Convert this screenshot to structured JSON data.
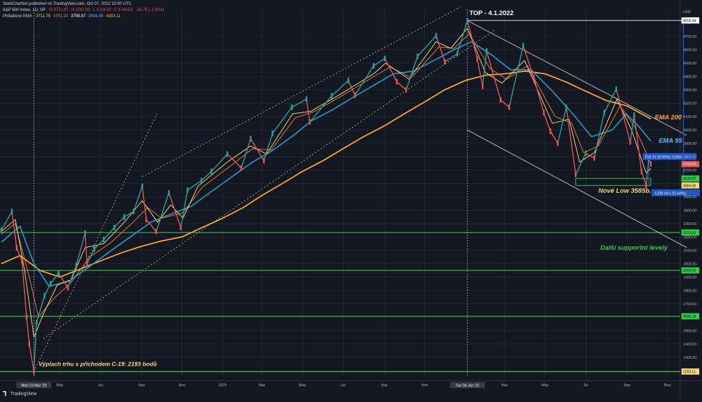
{
  "header": {
    "published": "StarkCharttist published on TradingView.com, Oct 07, 2022 10:00 UTC",
    "symbol_line": "S&P 500 Index, 1D, SP",
    "ohlc": [
      {
        "k": "O",
        "v": "3771.97",
        "c": "#ef5350"
      },
      {
        "k": "H",
        "v": "3797.93",
        "c": "#ef5350"
      },
      {
        "k": "L",
        "v": "3718.32",
        "c": "#ef5350"
      },
      {
        "k": "C",
        "v": "3744.52",
        "c": "#ef5350"
      },
      {
        "k": "",
        "v": "-38.76 (-1.02%)",
        "c": "#ef5350"
      }
    ],
    "indicator_name": "Phillabone EMA",
    "indicator_values": [
      {
        "v": "3711.79",
        "c": "#f5d76e"
      },
      {
        "v": "3751.20",
        "c": "#e07b39"
      },
      {
        "v": "3798.87",
        "c": "#ffffff"
      },
      {
        "v": "3916.06",
        "c": "#4fc3f7"
      },
      {
        "v": "4083.11",
        "c": "#ffa726"
      }
    ]
  },
  "footer": {
    "brand": "TradingView"
  },
  "colors": {
    "background": "#131722",
    "grid": "#2a2e39",
    "up": "#26a69a",
    "down": "#ef5350",
    "ema_fast": "#f5d76e",
    "ema_mid": "#e07b39",
    "ema55": "#1fa0d0",
    "ema200": "#ffa726",
    "support": "#2ecc40",
    "channel": "#c8c8c8",
    "dotted_channel": "#c9b458"
  },
  "chart_data": {
    "type": "line",
    "title": "S&P 500 Index, 1D, SP",
    "y_axis_label": "USD",
    "ylim": [
      2150,
      4900
    ],
    "y_ticks": [
      2300,
      2400,
      2500,
      2600,
      2700,
      2800,
      2900,
      3000,
      3100,
      3200,
      3300,
      3400,
      3500,
      3600,
      3700,
      3800,
      3900,
      4000,
      4100,
      4200,
      4300,
      4400,
      4500,
      4600,
      4700
    ],
    "xlim": [
      "2020-02-01",
      "2022-11-20"
    ],
    "x_ticks": [
      {
        "date": "2020-05-01",
        "label": "May"
      },
      {
        "date": "2020-07-01",
        "label": "Jul"
      },
      {
        "date": "2020-09-01",
        "label": "Sep"
      },
      {
        "date": "2020-11-01",
        "label": "Nov"
      },
      {
        "date": "2021-01-01",
        "label": "2021"
      },
      {
        "date": "2021-03-01",
        "label": "Mar"
      },
      {
        "date": "2021-05-01",
        "label": "May"
      },
      {
        "date": "2021-07-01",
        "label": "Jul"
      },
      {
        "date": "2021-09-01",
        "label": "Sep"
      },
      {
        "date": "2021-11-01",
        "label": "Nov"
      },
      {
        "date": "2022-03-01",
        "label": "Mar"
      },
      {
        "date": "2022-05-01",
        "label": "May"
      },
      {
        "date": "2022-07-01",
        "label": "Jul"
      },
      {
        "date": "2022-09-01",
        "label": "Sep"
      },
      {
        "date": "2022-11-01",
        "label": "Nov"
      }
    ],
    "x_markers": [
      {
        "date": "2020-03-23",
        "label": "Mon 23 Mar '20"
      },
      {
        "date": "2022-01-04",
        "label": "Tue 04 Jan '22"
      }
    ],
    "price": [
      [
        "2020-02-03",
        3250
      ],
      [
        "2020-02-19",
        3390
      ],
      [
        "2020-02-26",
        3120
      ],
      [
        "2020-03-05",
        3020
      ],
      [
        "2020-03-12",
        2600
      ],
      [
        "2020-03-16",
        2400
      ],
      [
        "2020-03-23",
        2193
      ],
      [
        "2020-03-27",
        2560
      ],
      [
        "2020-04-08",
        2760
      ],
      [
        "2020-04-17",
        2850
      ],
      [
        "2020-04-29",
        2930
      ],
      [
        "2020-05-13",
        2820
      ],
      [
        "2020-05-26",
        2990
      ],
      [
        "2020-06-08",
        3230
      ],
      [
        "2020-06-11",
        3000
      ],
      [
        "2020-06-22",
        3110
      ],
      [
        "2020-07-06",
        3180
      ],
      [
        "2020-07-22",
        3270
      ],
      [
        "2020-08-06",
        3350
      ],
      [
        "2020-08-20",
        3390
      ],
      [
        "2020-09-02",
        3580
      ],
      [
        "2020-09-08",
        3330
      ],
      [
        "2020-09-23",
        3240
      ],
      [
        "2020-10-12",
        3530
      ],
      [
        "2020-10-30",
        3270
      ],
      [
        "2020-11-09",
        3550
      ],
      [
        "2020-11-30",
        3620
      ],
      [
        "2020-12-15",
        3690
      ],
      [
        "2021-01-08",
        3820
      ],
      [
        "2021-01-29",
        3715
      ],
      [
        "2021-02-12",
        3935
      ],
      [
        "2021-03-04",
        3770
      ],
      [
        "2021-03-17",
        3975
      ],
      [
        "2021-04-15",
        4170
      ],
      [
        "2021-05-07",
        4230
      ],
      [
        "2021-05-12",
        4060
      ],
      [
        "2021-06-14",
        4255
      ],
      [
        "2021-07-09",
        4370
      ],
      [
        "2021-07-19",
        4260
      ],
      [
        "2021-08-16",
        4480
      ],
      [
        "2021-09-02",
        4535
      ],
      [
        "2021-09-20",
        4360
      ],
      [
        "2021-10-04",
        4300
      ],
      [
        "2021-10-21",
        4550
      ],
      [
        "2021-11-18",
        4705
      ],
      [
        "2021-12-01",
        4510
      ],
      [
        "2021-12-20",
        4570
      ],
      [
        "2022-01-04",
        4818
      ],
      [
        "2022-01-19",
        4530
      ],
      [
        "2022-01-27",
        4326
      ],
      [
        "2022-02-02",
        4590
      ],
      [
        "2022-02-23",
        4225
      ],
      [
        "2022-03-08",
        4170
      ],
      [
        "2022-03-29",
        4630
      ],
      [
        "2022-04-14",
        4390
      ],
      [
        "2022-04-29",
        4130
      ],
      [
        "2022-05-09",
        3990
      ],
      [
        "2022-05-20",
        3900
      ],
      [
        "2022-06-02",
        4170
      ],
      [
        "2022-06-16",
        3666
      ],
      [
        "2022-07-01",
        3825
      ],
      [
        "2022-07-14",
        3790
      ],
      [
        "2022-07-29",
        4130
      ],
      [
        "2022-08-16",
        4305
      ],
      [
        "2022-09-06",
        3910
      ],
      [
        "2022-09-12",
        4110
      ],
      [
        "2022-09-23",
        3690
      ],
      [
        "2022-09-30",
        3585
      ],
      [
        "2022-10-04",
        3790
      ],
      [
        "2022-10-07",
        3745
      ]
    ],
    "ema200": [
      [
        "2020-02-03",
        3000
      ],
      [
        "2020-03-02",
        3060
      ],
      [
        "2020-04-01",
        2950
      ],
      [
        "2020-05-01",
        2900
      ],
      [
        "2020-06-01",
        2960
      ],
      [
        "2020-07-01",
        3020
      ],
      [
        "2020-08-01",
        3080
      ],
      [
        "2020-09-01",
        3130
      ],
      [
        "2020-10-01",
        3170
      ],
      [
        "2020-11-01",
        3200
      ],
      [
        "2020-12-01",
        3270
      ],
      [
        "2021-01-01",
        3340
      ],
      [
        "2021-02-01",
        3420
      ],
      [
        "2021-03-01",
        3510
      ],
      [
        "2021-04-01",
        3600
      ],
      [
        "2021-05-01",
        3690
      ],
      [
        "2021-06-01",
        3770
      ],
      [
        "2021-07-01",
        3860
      ],
      [
        "2021-08-01",
        3950
      ],
      [
        "2021-09-01",
        4030
      ],
      [
        "2021-10-01",
        4120
      ],
      [
        "2021-11-01",
        4210
      ],
      [
        "2021-12-01",
        4300
      ],
      [
        "2022-01-01",
        4370
      ],
      [
        "2022-02-01",
        4410
      ],
      [
        "2022-03-01",
        4420
      ],
      [
        "2022-04-01",
        4440
      ],
      [
        "2022-05-01",
        4420
      ],
      [
        "2022-06-01",
        4360
      ],
      [
        "2022-07-01",
        4290
      ],
      [
        "2022-08-01",
        4220
      ],
      [
        "2022-09-01",
        4180
      ],
      [
        "2022-10-07",
        4083
      ]
    ],
    "ema55": [
      [
        "2020-02-03",
        3160
      ],
      [
        "2020-03-02",
        3280
      ],
      [
        "2020-03-23",
        3000
      ],
      [
        "2020-04-15",
        2830
      ],
      [
        "2020-05-15",
        2870
      ],
      [
        "2020-06-15",
        2980
      ],
      [
        "2020-07-15",
        3090
      ],
      [
        "2020-08-15",
        3200
      ],
      [
        "2020-09-15",
        3310
      ],
      [
        "2020-10-15",
        3370
      ],
      [
        "2020-11-15",
        3430
      ],
      [
        "2020-12-15",
        3540
      ],
      [
        "2021-01-15",
        3650
      ],
      [
        "2021-02-15",
        3760
      ],
      [
        "2021-03-15",
        3840
      ],
      [
        "2021-04-15",
        3950
      ],
      [
        "2021-05-15",
        4070
      ],
      [
        "2021-06-15",
        4150
      ],
      [
        "2021-07-15",
        4240
      ],
      [
        "2021-08-15",
        4330
      ],
      [
        "2021-09-15",
        4420
      ],
      [
        "2021-10-15",
        4440
      ],
      [
        "2021-11-15",
        4520
      ],
      [
        "2021-12-15",
        4600
      ],
      [
        "2022-01-10",
        4660
      ],
      [
        "2022-02-10",
        4560
      ],
      [
        "2022-03-10",
        4450
      ],
      [
        "2022-04-10",
        4450
      ],
      [
        "2022-05-10",
        4300
      ],
      [
        "2022-06-10",
        4130
      ],
      [
        "2022-07-10",
        3950
      ],
      [
        "2022-08-10",
        4000
      ],
      [
        "2022-08-31",
        4120
      ],
      [
        "2022-09-20",
        4020
      ],
      [
        "2022-10-07",
        3916
      ]
    ],
    "ema_fast": [
      [
        "2020-02-03",
        3240
      ],
      [
        "2020-02-24",
        3330
      ],
      [
        "2020-03-09",
        2950
      ],
      [
        "2020-03-23",
        2450
      ],
      [
        "2020-04-06",
        2620
      ],
      [
        "2020-04-27",
        2840
      ],
      [
        "2020-05-18",
        2880
      ],
      [
        "2020-06-08",
        3120
      ],
      [
        "2020-07-06",
        3150
      ],
      [
        "2020-08-06",
        3310
      ],
      [
        "2020-09-02",
        3470
      ],
      [
        "2020-09-25",
        3310
      ],
      [
        "2020-10-15",
        3440
      ],
      [
        "2020-11-02",
        3340
      ],
      [
        "2020-11-25",
        3580
      ],
      [
        "2021-01-08",
        3760
      ],
      [
        "2021-02-12",
        3880
      ],
      [
        "2021-03-08",
        3820
      ],
      [
        "2021-04-16",
        4120
      ],
      [
        "2021-05-14",
        4140
      ],
      [
        "2021-06-28",
        4270
      ],
      [
        "2021-08-16",
        4420
      ],
      [
        "2021-09-03",
        4500
      ],
      [
        "2021-10-08",
        4380
      ],
      [
        "2021-11-18",
        4660
      ],
      [
        "2021-12-10",
        4610
      ],
      [
        "2022-01-04",
        4760
      ],
      [
        "2022-01-31",
        4430
      ],
      [
        "2022-02-25",
        4350
      ],
      [
        "2022-03-31",
        4520
      ],
      [
        "2022-05-12",
        4050
      ],
      [
        "2022-06-06",
        4080
      ],
      [
        "2022-06-22",
        3760
      ],
      [
        "2022-07-14",
        3830
      ],
      [
        "2022-08-17",
        4230
      ],
      [
        "2022-09-08",
        4000
      ],
      [
        "2022-09-30",
        3680
      ],
      [
        "2022-10-07",
        3711
      ]
    ],
    "ema_mid": [
      [
        "2020-02-03",
        3220
      ],
      [
        "2020-02-24",
        3300
      ],
      [
        "2020-03-16",
        2900
      ],
      [
        "2020-03-30",
        2600
      ],
      [
        "2020-04-20",
        2730
      ],
      [
        "2020-05-18",
        2860
      ],
      [
        "2020-06-15",
        3050
      ],
      [
        "2020-07-15",
        3150
      ],
      [
        "2020-08-15",
        3290
      ],
      [
        "2020-09-10",
        3420
      ],
      [
        "2020-10-01",
        3340
      ],
      [
        "2020-11-02",
        3380
      ],
      [
        "2020-12-01",
        3570
      ],
      [
        "2021-01-15",
        3740
      ],
      [
        "2021-02-15",
        3860
      ],
      [
        "2021-03-15",
        3850
      ],
      [
        "2021-04-20",
        4090
      ],
      [
        "2021-05-20",
        4140
      ],
      [
        "2021-07-01",
        4260
      ],
      [
        "2021-08-20",
        4410
      ],
      [
        "2021-09-10",
        4470
      ],
      [
        "2021-10-12",
        4390
      ],
      [
        "2021-11-22",
        4620
      ],
      [
        "2021-12-15",
        4610
      ],
      [
        "2022-01-07",
        4720
      ],
      [
        "2022-02-07",
        4460
      ],
      [
        "2022-03-04",
        4380
      ],
      [
        "2022-04-04",
        4480
      ],
      [
        "2022-05-16",
        4100
      ],
      [
        "2022-06-10",
        4050
      ],
      [
        "2022-06-28",
        3830
      ],
      [
        "2022-07-20",
        3880
      ],
      [
        "2022-08-22",
        4180
      ],
      [
        "2022-09-12",
        4030
      ],
      [
        "2022-10-07",
        3751
      ]
    ],
    "support_levels": [
      3233.0,
      2949.42,
      2606.28,
      2193.11
    ],
    "level_box": {
      "from": "2022-06-16",
      "to": "2022-10-07",
      "top": 3636.87,
      "bottom": 3584.9,
      "color": "#2ecc40"
    },
    "measures": [
      {
        "label": "216.31 (6.03%) 21651",
        "value": 3801.21,
        "color": "#1e56c8"
      },
      {
        "label": "-1236.44 (-25.64%)",
        "value": 3530,
        "color": "#1e56c8"
      }
    ],
    "channels": [
      {
        "kind": "solid",
        "p1": [
          "2022-01-04",
          4818
        ],
        "p2": [
          "2022-11-30",
          3960
        ]
      },
      {
        "kind": "solid",
        "p1": [
          "2022-01-04",
          4000
        ],
        "p2": [
          "2022-11-30",
          3120
        ]
      },
      {
        "kind": "dotted",
        "p1": [
          "2020-09-02",
          3650
        ],
        "p2": [
          "2021-12-25",
          4920
        ]
      },
      {
        "kind": "dotted",
        "p1": [
          "2020-04-06",
          2440
        ],
        "p2": [
          "2022-02-15",
          4750
        ]
      },
      {
        "kind": "dotted",
        "p1": [
          "2020-03-23",
          2193
        ],
        "p2": [
          "2020-09-25",
          4130
        ]
      }
    ],
    "top_line": {
      "from": "2022-01-04",
      "to": "2022-11-28",
      "value": 4818.62
    },
    "vertical_markers": [
      "2020-03-23",
      "2022-01-04"
    ],
    "price_labels": [
      {
        "text": "4818.94",
        "value": 4818.94,
        "bg": "#ffffff",
        "fg": "#131722"
      },
      {
        "text": "3744.52",
        "value": 3744.52,
        "bg": "#ef5350",
        "fg": "#ffffff"
      },
      {
        "text": "3636.87",
        "value": 3636.87,
        "bg": "#2ecc40",
        "fg": "#131722"
      },
      {
        "text": "3584.90",
        "value": 3584.9,
        "bg": "#f5d76e",
        "fg": "#131722"
      },
      {
        "text": "3233.00",
        "value": 3233.0,
        "bg": "#2ecc40",
        "fg": "#131722"
      },
      {
        "text": "2949.42",
        "value": 2949.42,
        "bg": "#2ecc40",
        "fg": "#131722"
      },
      {
        "text": "2606.28",
        "value": 2606.28,
        "bg": "#2ecc40",
        "fg": "#131722"
      },
      {
        "text": "2193.11",
        "value": 2193.11,
        "bg": "#f5d76e",
        "fg": "#131722"
      }
    ],
    "annotations": [
      {
        "text": "TOP - 4.1.2022",
        "date": "2022-01-07",
        "value": 4860,
        "color": "#ffffff",
        "italic": false
      },
      {
        "text": "EMA 200",
        "date": "2022-10-13",
        "value": 4080,
        "color": "#ffa726",
        "italic": true
      },
      {
        "text": "EMA 55",
        "date": "2022-10-19",
        "value": 3905,
        "color": "#4fc3f7",
        "italic": true
      },
      {
        "text": "Nové Low 3585b.",
        "date": "2022-07-20",
        "value": 3530,
        "color": "#f5d76e",
        "italic": true
      },
      {
        "text": "Další supportní levely",
        "date": "2022-07-23",
        "value": 3105,
        "color": "#2ecc40",
        "italic": true
      },
      {
        "text": "Výplach trhu s příchodem C-19: 2193 bodů",
        "date": "2020-03-30",
        "value": 2235,
        "color": "#f5d76e",
        "italic": true
      }
    ]
  }
}
